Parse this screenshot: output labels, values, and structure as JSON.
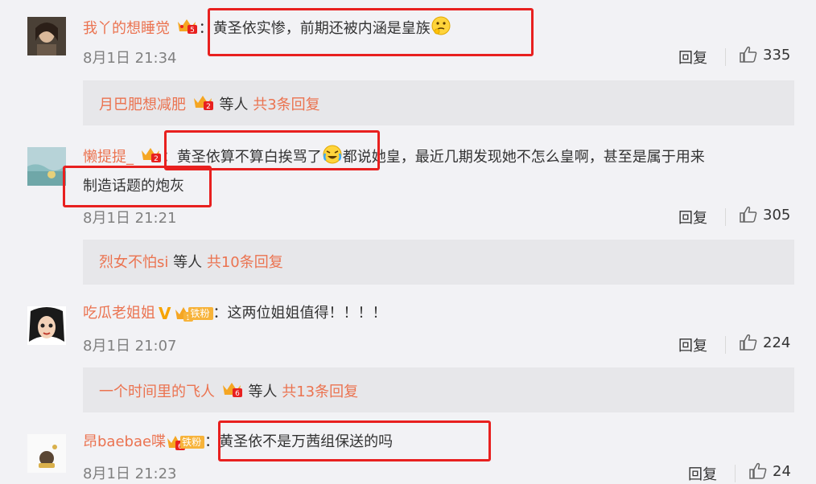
{
  "comments": [
    {
      "user": "我丫的想睡觉",
      "text": "黄圣依实惨，前期还被内涵是皇族",
      "emoji_name": "thinking-emoji",
      "time": "8月1日 21:34",
      "reply_label": "回复",
      "likes": "335",
      "sub": {
        "first_user": "月巴肥想减肥",
        "rest": "等人",
        "count": "共3条回复"
      }
    },
    {
      "user": "懒提提_",
      "text_1": "黄圣依算不算白挨骂了",
      "emoji_name": "laugh-cry-emoji",
      "text_2": "都说她皇，最近几期发现她不怎么皇啊，甚至是属于用来",
      "text_3": "制造话题的炮灰",
      "time": "8月1日 21:21",
      "reply_label": "回复",
      "likes": "305",
      "sub": {
        "first_user": "烈女不怕si",
        "rest": "等人",
        "count": "共10条回复"
      }
    },
    {
      "user": "吃瓜老姐姐",
      "fan_label": "铁粉",
      "text": "这两位姐姐值得！！！！",
      "time": "8月1日 21:07",
      "reply_label": "回复",
      "likes": "224",
      "sub": {
        "first_user": "一个时间里的飞人",
        "rest": "等人",
        "count": "共13条回复"
      }
    },
    {
      "user": "昂baebae喋",
      "fan_label": "铁粉",
      "text": "黄圣依不是万茜组保送的吗",
      "time": "8月1日 21:23",
      "reply_label": "回复",
      "likes": "24"
    }
  ],
  "colors": {
    "username": "#eb7350",
    "highlight": "#e8201f",
    "background": "#f2f2f5",
    "sub_background": "#e7e7ea"
  }
}
